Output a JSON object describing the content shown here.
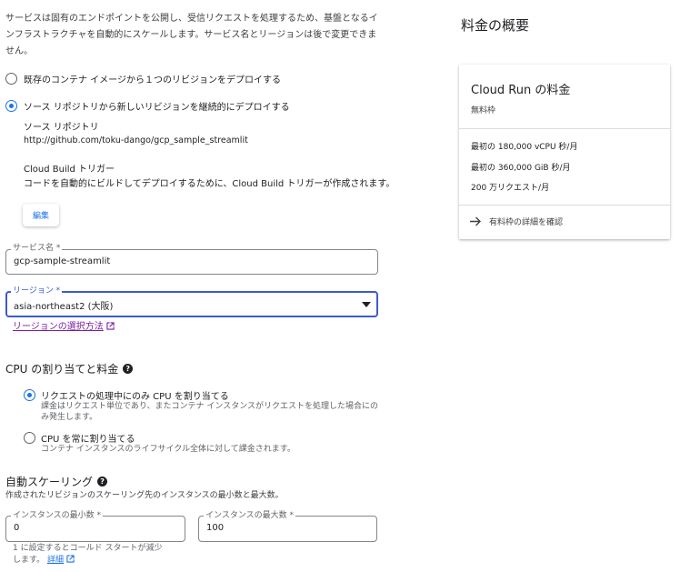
{
  "intro": {
    "text": "サービスは固有のエンドポイントを公開し、受信リクエストを処理するため、基盤となるインフラストラクチャを自動的にスケールします。サービス名とリージョンは後で変更できません。"
  },
  "deploy_options": {
    "option1": "既存のコンテナ イメージから１つのリビジョンをデプロイする",
    "option2": "ソース リポジトリから新しいリビジョンを継続的にデプロイする",
    "selected": "option2"
  },
  "source_repo": {
    "title": "ソース リポジトリ",
    "url": "http://github.com/toku-dango/gcp_sample_streamlit"
  },
  "cloud_build": {
    "title": "Cloud Build トリガー",
    "description": "コードを自動的にビルドしてデプロイするために、Cloud Build トリガーが作成されます。",
    "edit_label": "編集"
  },
  "service_name": {
    "label": "サービス名 *",
    "value": "gcp-sample-streamlit"
  },
  "region": {
    "label": "リージョン *",
    "value": "asia-northeast2 (大阪)",
    "help_link": "リージョンの選択方法"
  },
  "cpu_section": {
    "title": "CPU の割り当てと料金",
    "option1_label": "リクエストの処理中にのみ CPU を割り当てる",
    "option1_desc": "課金はリクエスト単位であり、またコンテナ インスタンスがリクエストを処理した場合にのみ発生します。",
    "option2_label": "CPU を常に割り当てる",
    "option2_desc": "コンテナ インスタンスのライフサイクル全体に対して課金されます。",
    "selected": "option1"
  },
  "autoscaling": {
    "title": "自動スケーリング",
    "description": "作成されたリビジョンのスケーリング先のインスタンスの最小数と最大数。",
    "min_label": "インスタンスの最小数 *",
    "min_value": "0",
    "max_label": "インスタンスの最大数 *",
    "max_value": "100",
    "hint": "1 に設定するとコールド スタートが減少します。",
    "hint_link": "詳細"
  },
  "pricing": {
    "heading": "料金の概要",
    "card_title": "Cloud Run の料金",
    "card_subtitle": "無料枠",
    "line1": "最初の 180,000 vCPU 秒/月",
    "line2": "最初の 360,000 GiB 秒/月",
    "line3": "200 万リクエスト/月",
    "details_link": "有料枠の詳細を確認"
  },
  "colors": {
    "accent": "#1a73e8",
    "focus_border": "#3c5bcf",
    "link_purple": "#7b1fa2"
  }
}
